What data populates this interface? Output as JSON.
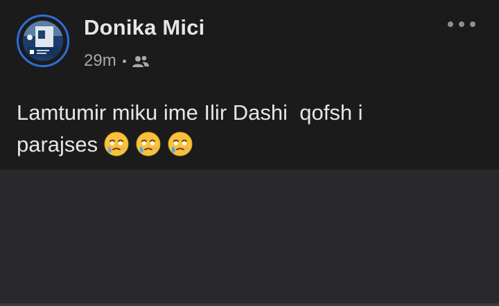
{
  "post": {
    "author": "Donika Mici",
    "timestamp": "29m",
    "audience_icon": "friends-icon",
    "more_icon": "more-options-icon",
    "text_line1": "Lamtumir miku ime Ilir Dashi  qofsh i",
    "text_line2": "parajses",
    "emojis": [
      "face-holding-back-tears",
      "face-holding-back-tears",
      "face-holding-back-tears"
    ]
  },
  "colors": {
    "post_bg": "#1b1b1c",
    "page_bg": "#29292b",
    "text": "#e6e6e8",
    "meta_text": "#a8a9ad",
    "avatar_ring": "#2d6fdc"
  }
}
